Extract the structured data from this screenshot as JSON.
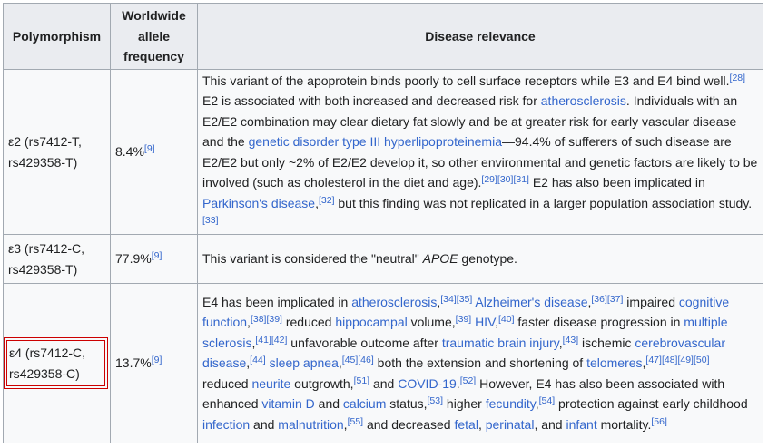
{
  "headers": {
    "polymorphism": "Polymorphism",
    "frequency": "Worldwide allele frequency",
    "relevance": "Disease relevance"
  },
  "rows": [
    {
      "poly": "ε2 (rs7412-T, rs429358-T)",
      "freq": "8.4%",
      "freq_ref": "[9]",
      "segments": [
        {
          "t": "This variant of the apoprotein binds poorly to cell surface receptors while E3 and E4 bind well."
        },
        {
          "ref": "[28]"
        },
        {
          "t": " E2 is associated with both increased and decreased risk for "
        },
        {
          "link": "atherosclerosis"
        },
        {
          "t": ". Individuals with an E2/E2 combination may clear dietary fat slowly and be at greater risk for early vascular disease and the "
        },
        {
          "link": "genetic disorder type III hyperlipoproteinemia"
        },
        {
          "t": "—94.4% of sufferers of such disease are E2/E2 but only ~2% of E2/E2 develop it, so other environmental and genetic factors are likely to be involved (such as cholesterol in the diet and age)."
        },
        {
          "ref": "[29]"
        },
        {
          "ref": "[30]"
        },
        {
          "ref": "[31]"
        },
        {
          "t": " E2 has also been implicated in "
        },
        {
          "link": "Parkinson's disease"
        },
        {
          "t": ","
        },
        {
          "ref": "[32]"
        },
        {
          "t": " but this finding was not replicated in a larger population association study."
        },
        {
          "ref": "[33]"
        }
      ]
    },
    {
      "poly": "ε3 (rs7412-C, rs429358-T)",
      "freq": "77.9%",
      "freq_ref": "[9]",
      "segments": [
        {
          "t": "This variant is considered the \"neutral\" "
        },
        {
          "it": "APOE"
        },
        {
          "t": " genotype."
        }
      ]
    },
    {
      "poly": "ε4 (rs7412-C, rs429358-C)",
      "freq": "13.7%",
      "freq_ref": "[9]",
      "highlighted": true,
      "segments": [
        {
          "t": "E4 has been implicated in "
        },
        {
          "link": "atherosclerosis"
        },
        {
          "t": ","
        },
        {
          "ref": "[34]"
        },
        {
          "ref": "[35]"
        },
        {
          "t": " "
        },
        {
          "link": "Alzheimer's disease"
        },
        {
          "t": ","
        },
        {
          "ref": "[36]"
        },
        {
          "ref": "[37]"
        },
        {
          "t": " impaired "
        },
        {
          "link": "cognitive function"
        },
        {
          "t": ","
        },
        {
          "ref": "[38]"
        },
        {
          "ref": "[39]"
        },
        {
          "t": " reduced "
        },
        {
          "link": "hippocampal"
        },
        {
          "t": " volume,"
        },
        {
          "ref": "[39]"
        },
        {
          "t": " "
        },
        {
          "link": "HIV"
        },
        {
          "t": ","
        },
        {
          "ref": "[40]"
        },
        {
          "t": " faster disease progression in "
        },
        {
          "link": "multiple sclerosis"
        },
        {
          "t": ","
        },
        {
          "ref": "[41]"
        },
        {
          "ref": "[42]"
        },
        {
          "t": " unfavorable outcome after "
        },
        {
          "link": "traumatic brain injury"
        },
        {
          "t": ","
        },
        {
          "ref": "[43]"
        },
        {
          "t": " ischemic "
        },
        {
          "link": "cerebrovascular disease"
        },
        {
          "t": ","
        },
        {
          "ref": "[44]"
        },
        {
          "t": " "
        },
        {
          "link": "sleep apnea"
        },
        {
          "t": ","
        },
        {
          "ref": "[45]"
        },
        {
          "ref": "[46]"
        },
        {
          "t": " both the extension and shortening of "
        },
        {
          "link": "telomeres"
        },
        {
          "t": ","
        },
        {
          "ref": "[47]"
        },
        {
          "ref": "[48]"
        },
        {
          "ref": "[49]"
        },
        {
          "ref": "[50]"
        },
        {
          "t": " reduced "
        },
        {
          "link": "neurite"
        },
        {
          "t": " outgrowth,"
        },
        {
          "ref": "[51]"
        },
        {
          "t": " and "
        },
        {
          "link": "COVID-19"
        },
        {
          "t": "."
        },
        {
          "ref": "[52]"
        },
        {
          "t": " However, E4 has also been associated with enhanced "
        },
        {
          "link": "vitamin D"
        },
        {
          "t": " and "
        },
        {
          "link": "calcium"
        },
        {
          "t": " status,"
        },
        {
          "ref": "[53]"
        },
        {
          "t": " higher "
        },
        {
          "link": "fecundity"
        },
        {
          "t": ","
        },
        {
          "ref": "[54]"
        },
        {
          "t": " protection against early childhood "
        },
        {
          "link": "infection"
        },
        {
          "t": " and "
        },
        {
          "link": "malnutrition"
        },
        {
          "t": ","
        },
        {
          "ref": "[55]"
        },
        {
          "t": " and decreased "
        },
        {
          "link": "fetal"
        },
        {
          "t": ", "
        },
        {
          "link": "perinatal"
        },
        {
          "t": ", and "
        },
        {
          "link": "infant"
        },
        {
          "t": " mortality."
        },
        {
          "ref": "[56]"
        }
      ]
    }
  ]
}
